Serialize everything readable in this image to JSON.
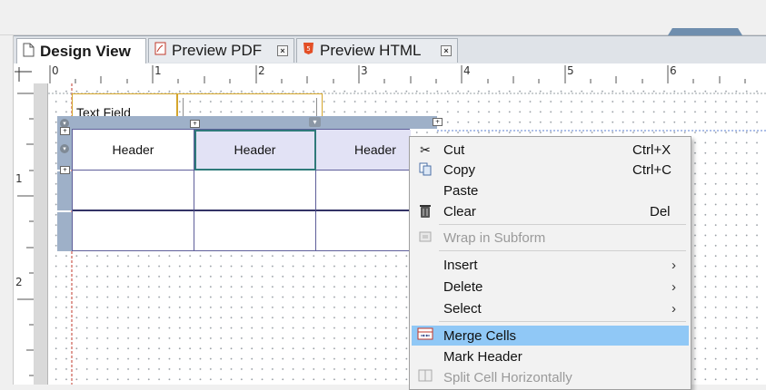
{
  "tabs": [
    {
      "label": "Design View",
      "icon": "document-icon",
      "active": true
    },
    {
      "label": "Preview PDF",
      "icon": "pdf-icon",
      "close": "×"
    },
    {
      "label": "Preview HTML",
      "icon": "html5-icon",
      "close": "×"
    }
  ],
  "ruler": {
    "h_labels": [
      "0",
      "1",
      "2",
      "3",
      "4",
      "5",
      "6"
    ],
    "v_labels": [
      "1",
      "2"
    ]
  },
  "form": {
    "text_field_label": "Text Field",
    "table_headers": [
      "Header",
      "Header",
      "Header"
    ]
  },
  "context_menu": {
    "items": [
      {
        "label": "Cut",
        "shortcut": "Ctrl+X",
        "icon": "scissors-icon"
      },
      {
        "label": "Copy",
        "shortcut": "Ctrl+C",
        "icon": "copy-icon"
      },
      {
        "label": "Paste"
      },
      {
        "label": "Clear",
        "shortcut": "Del",
        "icon": "trash-icon"
      },
      {
        "label": "Wrap in Subform",
        "disabled": true,
        "icon": "wrap-subform-icon"
      },
      {
        "label": "Insert",
        "submenu": "›"
      },
      {
        "label": "Delete",
        "submenu": "›"
      },
      {
        "label": "Select",
        "submenu": "›"
      },
      {
        "label": "Merge Cells",
        "highlighted": true,
        "icon": "merge-cells-icon"
      },
      {
        "label": "Mark Header"
      },
      {
        "label": "Split Cell Horizontally",
        "disabled": true,
        "icon": "split-cell-icon"
      }
    ]
  },
  "colors": {
    "highlight": "#90c8f6",
    "table_bar": "#9eb0c8",
    "field_border": "#d5a62c"
  }
}
